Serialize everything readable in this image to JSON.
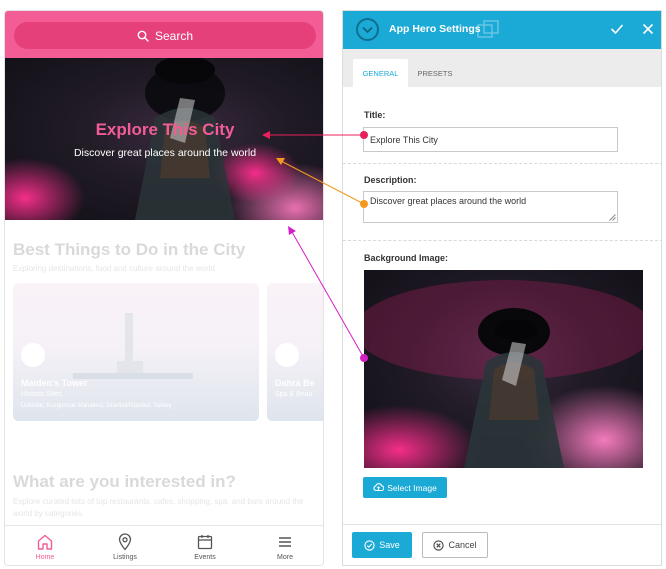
{
  "phone": {
    "search_label": "Search",
    "hero": {
      "title": "Explore This City",
      "description": "Discover great places around the world"
    },
    "section1": {
      "title": "Best Things to Do in the City",
      "subtitle": "Exploring destinations, food and culture around the world"
    },
    "cards": [
      {
        "title": "Maiden's Tower",
        "subtitle": "Historic Sites",
        "address": "Üsküdar, Kuzguncuk Mahallesi, İstanbul/İstanbul, Turkey"
      },
      {
        "title": "Dahra Be",
        "subtitle": "Spa & Beau"
      }
    ],
    "section2": {
      "title": "What are you interested in?",
      "subtitle": "Explore curated lists of top restaurants, cafes, shopping, spa, and bars around the world by categories."
    },
    "tabbar": [
      {
        "label": "Home",
        "icon": "home-icon",
        "active": true
      },
      {
        "label": "Listings",
        "icon": "map-pin-icon",
        "active": false
      },
      {
        "label": "Events",
        "icon": "calendar-icon",
        "active": false
      },
      {
        "label": "More",
        "icon": "menu-icon",
        "active": false
      }
    ]
  },
  "panel": {
    "title": "App Hero Settings",
    "tabs": [
      "GENERAL",
      "PRESETS"
    ],
    "active_tab": "GENERAL",
    "fields": {
      "title_label": "Title:",
      "title_value": "Explore This City",
      "description_label": "Description:",
      "description_value": "Discover great places around the world",
      "bg_label": "Background Image:"
    },
    "select_image_label": "Select Image",
    "save_label": "Save",
    "cancel_label": "Cancel"
  },
  "colors": {
    "accent_pink": "#f35c95",
    "panel_blue": "#1ba9d6",
    "arrow_red": "#e8205c",
    "arrow_orange": "#f39a1e",
    "arrow_magenta": "#d51fc6"
  }
}
